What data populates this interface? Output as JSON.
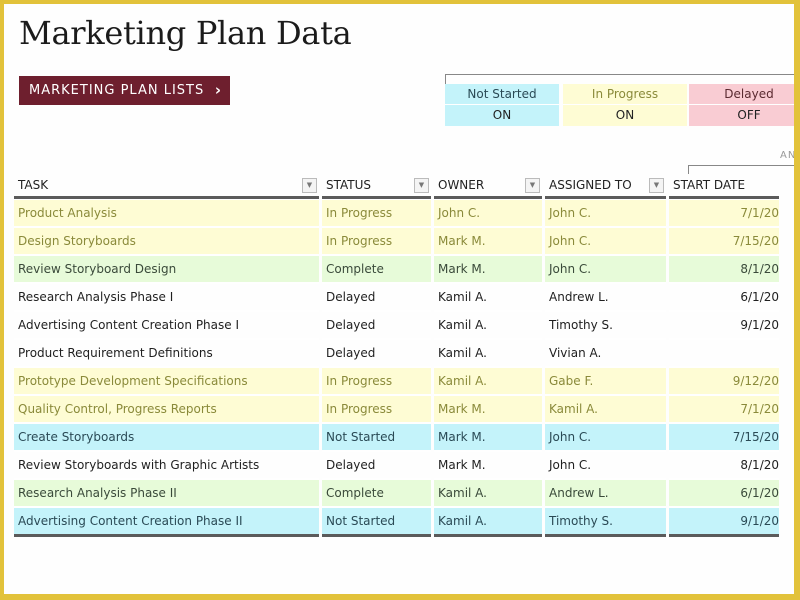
{
  "title": "Marketing Plan Data",
  "nav_button": {
    "label": "MARKETING PLAN LISTS",
    "icon": "chevron-right-icon"
  },
  "legend": [
    {
      "label": "Not Started",
      "value": "ON",
      "color": "#c4f3fa"
    },
    {
      "label": "In Progress",
      "value": "ON",
      "color": "#fefcd4"
    },
    {
      "label": "Delayed",
      "value": "OFF",
      "color": "#f9ccd3"
    }
  ],
  "group_label": "ANT",
  "table": {
    "columns": [
      "TASK",
      "STATUS",
      "OWNER",
      "ASSIGNED TO",
      "START DATE"
    ],
    "rows": [
      {
        "task": "Product Analysis",
        "status": "In Progress",
        "owner": "John C.",
        "assigned": "John C.",
        "start": "7/1/20"
      },
      {
        "task": "Design Storyboards",
        "status": "In Progress",
        "owner": "Mark M.",
        "assigned": "John C.",
        "start": "7/15/20"
      },
      {
        "task": "Review Storyboard Design",
        "status": "Complete",
        "owner": "Mark M.",
        "assigned": "John C.",
        "start": "8/1/20"
      },
      {
        "task": "Research Analysis Phase I",
        "status": "Delayed",
        "owner": "Kamil A.",
        "assigned": "Andrew L.",
        "start": "6/1/20"
      },
      {
        "task": "Advertising Content Creation Phase I",
        "status": "Delayed",
        "owner": "Kamil A.",
        "assigned": "Timothy S.",
        "start": "9/1/20"
      },
      {
        "task": "Product Requirement Definitions",
        "status": "Delayed",
        "owner": "Kamil A.",
        "assigned": "Vivian A.",
        "start": ""
      },
      {
        "task": "Prototype Development Specifications",
        "status": "In Progress",
        "owner": "Kamil A.",
        "assigned": "Gabe F.",
        "start": "9/12/20"
      },
      {
        "task": "Quality Control, Progress Reports",
        "status": "In Progress",
        "owner": "Mark M.",
        "assigned": "Kamil A.",
        "start": "7/1/20"
      },
      {
        "task": "Create Storyboards",
        "status": "Not Started",
        "owner": "Mark M.",
        "assigned": "John C.",
        "start": "7/15/20"
      },
      {
        "task": "Review Storyboards with Graphic Artists",
        "status": "Delayed",
        "owner": "Mark M.",
        "assigned": "John C.",
        "start": "8/1/20"
      },
      {
        "task": "Research Analysis Phase II",
        "status": "Complete",
        "owner": "Kamil A.",
        "assigned": "Andrew L.",
        "start": "6/1/20"
      },
      {
        "task": "Advertising Content Creation Phase II",
        "status": "Not Started",
        "owner": "Kamil A.",
        "assigned": "Timothy S.",
        "start": "9/1/20"
      }
    ]
  }
}
